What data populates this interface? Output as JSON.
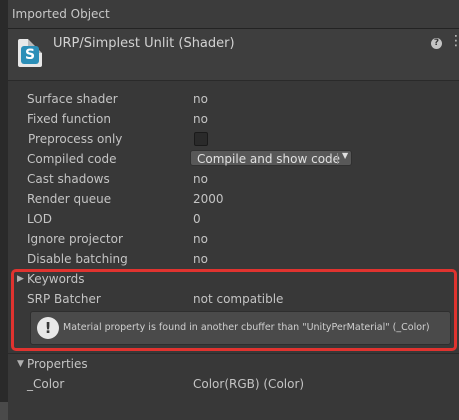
{
  "window": {
    "title": "Imported Object"
  },
  "header": {
    "object_title": "URP/Simplest Unlit (Shader)",
    "icon_letter": "S",
    "help_glyph": "?",
    "menu_glyph": "⋮"
  },
  "properties": [
    {
      "label": "Surface shader",
      "value": "no"
    },
    {
      "label": "Fixed function",
      "value": "no"
    },
    {
      "label": "Preprocess only",
      "value": ""
    },
    {
      "label": "Compiled code",
      "value": ""
    },
    {
      "label": "Cast shadows",
      "value": "no"
    },
    {
      "label": "Render queue",
      "value": "2000"
    },
    {
      "label": "LOD",
      "value": "0"
    },
    {
      "label": "Ignore projector",
      "value": "no"
    },
    {
      "label": "Disable batching",
      "value": "no"
    }
  ],
  "compile_button": {
    "label": "Compile and show code",
    "dropdown_glyph": "▼"
  },
  "keywords": {
    "label": "Keywords",
    "expanded": false
  },
  "srp_batcher": {
    "label": "SRP Batcher",
    "value": "not compatible"
  },
  "warning": {
    "icon_glyph": "!",
    "message": "Material property is found in another cbuffer than \"UnityPerMaterial\" (_Color)"
  },
  "properties_section": {
    "label": "Properties",
    "expanded": true,
    "items": [
      {
        "label": "_Color",
        "value": "Color(RGB) (Color)"
      }
    ]
  },
  "colors": {
    "panel_bg": "#383838",
    "highlight": "#e0332f",
    "shader_icon_accent": "#2c8fb8"
  }
}
